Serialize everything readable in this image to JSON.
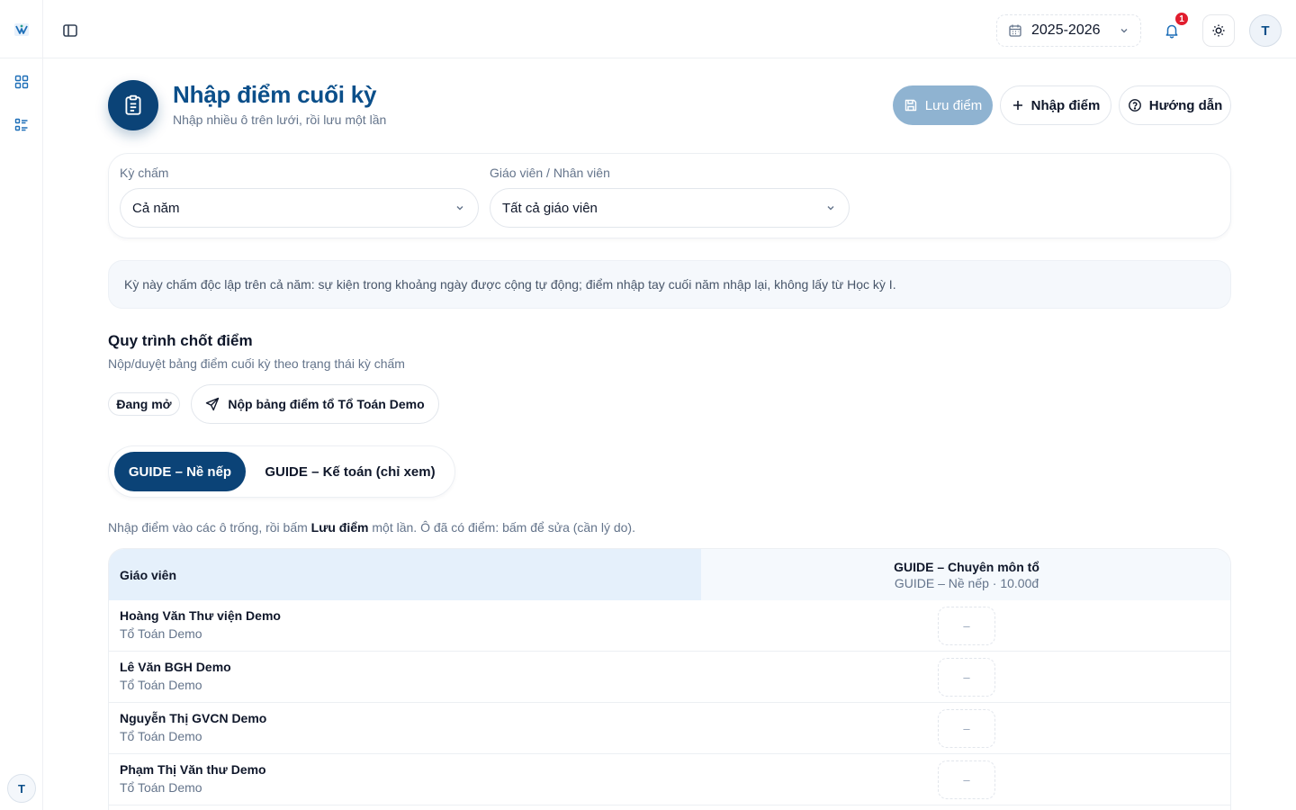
{
  "topbar": {
    "year": "2025-2026",
    "notification_count": "1",
    "user_initial": "T"
  },
  "sidebar": {
    "user_initial": "T"
  },
  "header": {
    "title": "Nhập điểm cuối kỳ",
    "subtitle": "Nhập nhiều ô trên lưới, rồi lưu một lần",
    "save_label": "Lưu điểm",
    "import_label": "Nhập điểm",
    "guide_label": "Hướng dẫn"
  },
  "filters": {
    "term_label": "Kỳ chấm",
    "term_value": "Cả năm",
    "teacher_label": "Giáo viên / Nhân viên",
    "teacher_value": "Tất cả giáo viên"
  },
  "info_text": "Kỳ này chấm độc lập trên cả năm: sự kiện trong khoảng ngày được cộng tự động; điểm nhập tay cuối năm nhập lại, không lấy từ Học kỳ I.",
  "workflow": {
    "title": "Quy trình chốt điểm",
    "subtitle": "Nộp/duyệt bảng điểm cuối kỳ theo trạng thái kỳ chấm",
    "status": "Đang mở",
    "submit_label": "Nộp bảng điểm tổ Tổ Toán Demo"
  },
  "tabs": [
    {
      "label": "GUIDE – Nề nếp",
      "active": true
    },
    {
      "label": "GUIDE – Kế toán (chỉ xem)",
      "active": false
    }
  ],
  "hint": {
    "before": "Nhập điểm vào các ô trống, rồi bấm ",
    "bold": "Lưu điểm",
    "after": " một lần. Ô đã có điểm: bấm để sửa (cần lý do)."
  },
  "grid": {
    "col_teacher": "Giáo viên",
    "col_criteria_title": "GUIDE – Chuyên môn tổ",
    "col_criteria_sub": "GUIDE – Nề nếp · 10.00đ",
    "rows": [
      {
        "name": "Hoàng Văn Thư viện Demo",
        "dept": "Tổ Toán Demo",
        "score": "–"
      },
      {
        "name": "Lê Văn BGH Demo",
        "dept": "Tổ Toán Demo",
        "score": "–"
      },
      {
        "name": "Nguyễn Thị GVCN Demo",
        "dept": "Tổ Toán Demo",
        "score": "–"
      },
      {
        "name": "Phạm Thị Văn thư Demo",
        "dept": "Tổ Toán Demo",
        "score": "–"
      }
    ]
  },
  "colors": {
    "primary": "#0b4377",
    "accent": "#1e6fb8",
    "save_disabled": "#8fb3d1",
    "badge": "#e11d2e"
  }
}
